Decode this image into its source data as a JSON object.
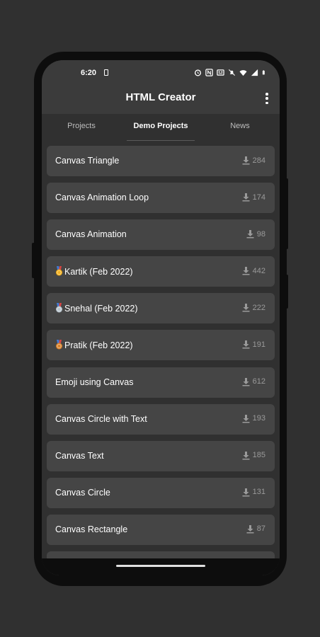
{
  "status": {
    "time": "6:20",
    "icons": [
      "sim-card-icon",
      "alarm-icon",
      "nfc-icon",
      "gallery-icon",
      "mute-icon",
      "wifi-icon",
      "signal-icon",
      "battery-icon"
    ]
  },
  "appbar": {
    "title": "HTML Creator",
    "menu_icon": "more-vert-icon"
  },
  "tabs": [
    {
      "label": "Projects",
      "active": false
    },
    {
      "label": "Demo Projects",
      "active": true
    },
    {
      "label": "News",
      "active": false
    }
  ],
  "projects": [
    {
      "title": "Canvas Triangle",
      "downloads": "284",
      "medal": null
    },
    {
      "title": "Canvas Animation Loop",
      "downloads": "174",
      "medal": null
    },
    {
      "title": "Canvas Animation",
      "downloads": "98",
      "medal": null
    },
    {
      "title": "Kartik (Feb 2022)",
      "downloads": "442",
      "medal": "gold"
    },
    {
      "title": "Snehal (Feb 2022)",
      "downloads": "222",
      "medal": "silver"
    },
    {
      "title": "Pratik (Feb 2022)",
      "downloads": "191",
      "medal": "bronze"
    },
    {
      "title": "Emoji using Canvas",
      "downloads": "612",
      "medal": null
    },
    {
      "title": "Canvas Circle with Text",
      "downloads": "193",
      "medal": null
    },
    {
      "title": "Canvas Text",
      "downloads": "185",
      "medal": null
    },
    {
      "title": "Canvas Circle",
      "downloads": "131",
      "medal": null
    },
    {
      "title": "Canvas Rectangle",
      "downloads": "87",
      "medal": null
    },
    {
      "title": "",
      "downloads": "",
      "medal": null
    }
  ],
  "colors": {
    "background": "#303030",
    "card": "#454545",
    "appbar": "#3b3b3b",
    "gold": "#f2b01e",
    "silver": "#b8c4cc",
    "bronze": "#d9822b",
    "ribbon": "#3f7bd6"
  }
}
